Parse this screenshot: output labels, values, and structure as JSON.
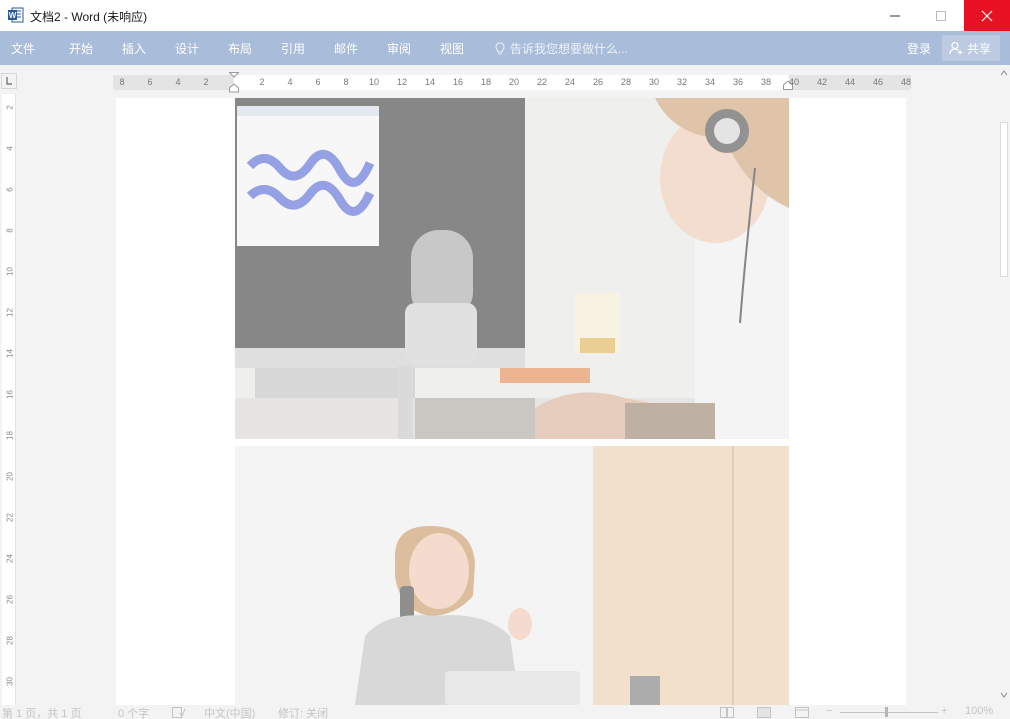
{
  "window": {
    "title": "文档2 - Word (未响应)",
    "icon": "word-app-icon",
    "accent": "#2b579a",
    "close_color": "#e81123"
  },
  "ribbon": {
    "bg": "#a9bcd9",
    "tabs": [
      "文件",
      "开始",
      "插入",
      "设计",
      "布局",
      "引用",
      "邮件",
      "审阅",
      "视图"
    ],
    "tell_me": "告诉我您想要做什么...",
    "login": "登录",
    "share": "共享"
  },
  "ruler": {
    "left_numbers": [
      "8",
      "6",
      "4",
      "2"
    ],
    "right_numbers": [
      "2",
      "4",
      "6",
      "8",
      "10",
      "12",
      "14",
      "16",
      "18",
      "20",
      "22",
      "24",
      "26",
      "28",
      "30",
      "32",
      "34",
      "36",
      "38",
      "40",
      "42",
      "44",
      "46",
      "48"
    ],
    "vertical_numbers": [
      "2",
      "4",
      "6",
      "8",
      "10",
      "12",
      "14",
      "16",
      "18",
      "20",
      "22",
      "24",
      "26",
      "28",
      "30"
    ]
  },
  "document": {
    "images": [
      "photo-podcast-microphone",
      "photo-woman-phone-call"
    ]
  },
  "statusbar": {
    "page": "第 1 页，共 1 页",
    "words": "0 个字",
    "language": "中文(中国)",
    "track_changes": "修订: 关闭",
    "zoom": "100%"
  }
}
